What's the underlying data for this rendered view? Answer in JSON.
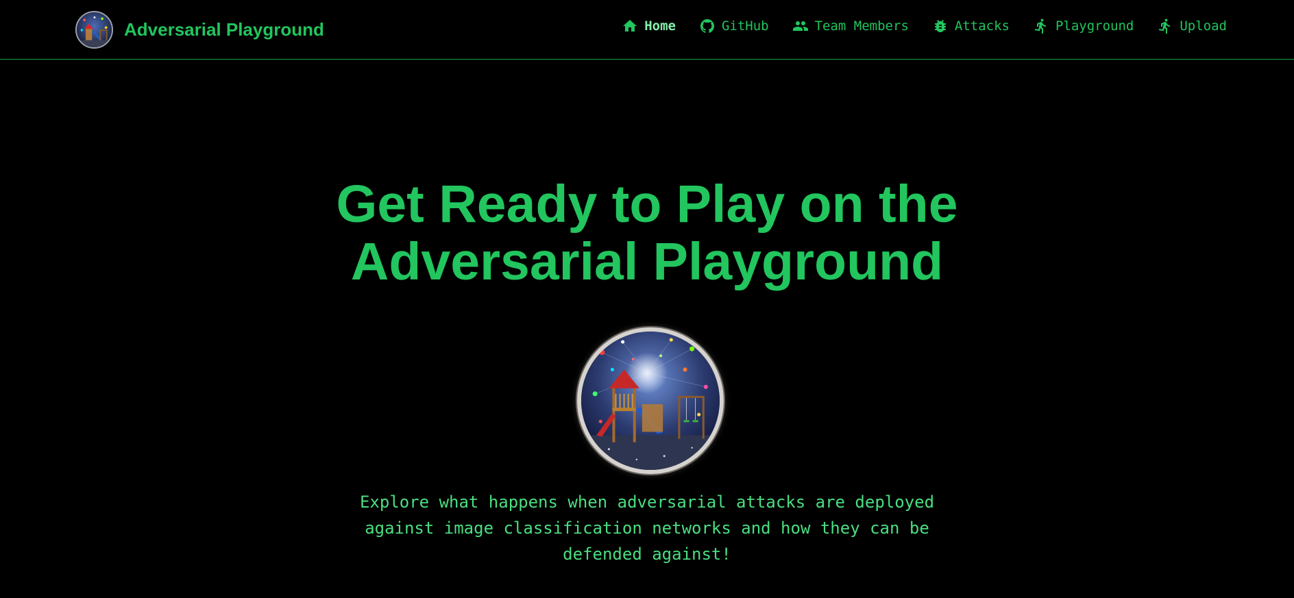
{
  "brand": {
    "title": "Adversarial Playground",
    "logo_icon": "playground-logo"
  },
  "nav": {
    "items": [
      {
        "label": "Home",
        "icon": "home-icon",
        "active": true
      },
      {
        "label": "GitHub",
        "icon": "github-icon",
        "active": false
      },
      {
        "label": "Team Members",
        "icon": "users-icon",
        "active": false
      },
      {
        "label": "Attacks",
        "icon": "bug-icon",
        "active": false
      },
      {
        "label": "Playground",
        "icon": "running-person-icon",
        "active": false
      },
      {
        "label": "Upload",
        "icon": "running-person-icon",
        "active": false
      }
    ]
  },
  "hero": {
    "title_line1": "Get Ready to Play on the",
    "title_line2": "Adversarial Playground",
    "image": "playground-illustration",
    "description": "Explore what happens when adversarial attacks are deployed against image classification networks and how they can be defended against!"
  },
  "colors": {
    "background": "#000000",
    "accent": "#22c55e",
    "accent_light": "#4ade80",
    "divider": "#16a34a"
  }
}
